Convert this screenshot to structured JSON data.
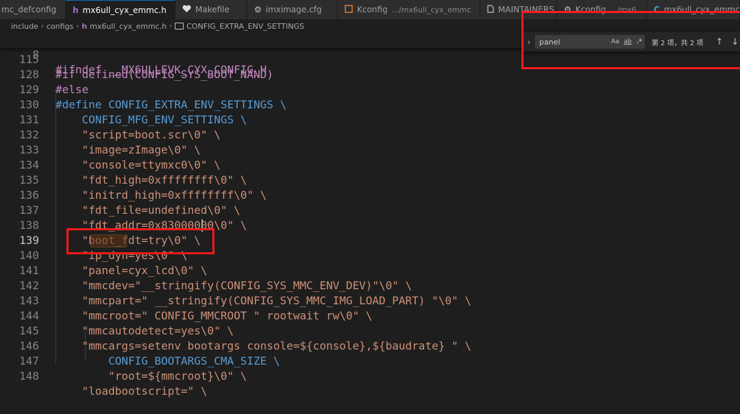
{
  "tabs": [
    {
      "label": "mc_defconfig",
      "icon": "",
      "active": false
    },
    {
      "label": "mx6ull_cyx_emmc.h",
      "icon": "h",
      "active": true
    },
    {
      "label": "Makefile",
      "icon": "makefile-icon",
      "active": false
    },
    {
      "label": "imximage.cfg",
      "icon": "gear-icon",
      "active": false
    },
    {
      "label": "Kconfig",
      "description": ".../mx6ull_cyx_emmc",
      "icon": "kconfig-icon",
      "active": false
    },
    {
      "label": "MAINTAINERS",
      "icon": "file-icon",
      "active": false
    },
    {
      "label": "Kconfig",
      "description": ".../mx6",
      "icon": "gear-icon",
      "active": false
    },
    {
      "label": "mx6ull_cyx_emmc",
      "icon": "C",
      "active": false
    }
  ],
  "breadcrumb": {
    "items": [
      "include",
      "configs",
      "mx6ull_cyx_emmc.h",
      "CONFIG_EXTRA_ENV_SETTINGS"
    ],
    "file_icon": "h"
  },
  "find": {
    "query": "panel",
    "match_case": "Aa",
    "whole_word": "ab",
    "regex": ".*",
    "count": "第 2 项，共 2 项",
    "toggle_icon": "chevron-right-icon"
  },
  "sticky": {
    "number": "8",
    "text": "#ifndef __MX6ULLEVK_CYX_CONFIG_H"
  },
  "lines": [
    {
      "n": "115",
      "t": "#if defined(CONFIG_SYS_BOOT_NAND)"
    },
    {
      "n": "128",
      "t": "#else"
    },
    {
      "n": "129",
      "t": "#define CONFIG_EXTRA_ENV_SETTINGS \\"
    },
    {
      "n": "130",
      "t": "    CONFIG_MFG_ENV_SETTINGS \\"
    },
    {
      "n": "131",
      "t": "    \"script=boot.scr\\0\" \\"
    },
    {
      "n": "132",
      "t": "    \"image=zImage\\0\" \\"
    },
    {
      "n": "133",
      "t": "    \"console=ttymxc0\\0\" \\"
    },
    {
      "n": "134",
      "t": "    \"fdt_high=0xffffffff\\0\" \\"
    },
    {
      "n": "135",
      "t": "    \"initrd_high=0xffffffff\\0\" \\"
    },
    {
      "n": "136",
      "t": "    \"fdt_file=undefined\\0\" \\"
    },
    {
      "n": "137",
      "t": "    \"fdt_addr=0x83000000\\0\" \\"
    },
    {
      "n": "138",
      "t": "    \"boot_fdt=try\\0\" \\"
    },
    {
      "n": "139",
      "t": "    \"ip_dyn=yes\\0\" \\"
    },
    {
      "n": "140",
      "t": "    \"panel=cyx_lcd\\0\" \\"
    },
    {
      "n": "141",
      "t": "    \"mmcdev=\"__stringify(CONFIG_SYS_MMC_ENV_DEV)\"\\0\" \\"
    },
    {
      "n": "142",
      "t": "    \"mmcpart=\" __stringify(CONFIG_SYS_MMC_IMG_LOAD_PART) \"\\0\" \\"
    },
    {
      "n": "143",
      "t": "    \"mmcroot=\" CONFIG_MMCROOT \" rootwait rw\\0\" \\"
    },
    {
      "n": "144",
      "t": "    \"mmcautodetect=yes\\0\" \\"
    },
    {
      "n": "145",
      "t": "    \"mmcargs=setenv bootargs console=${console},${baudrate} \" \\"
    },
    {
      "n": "146",
      "t": "        CONFIG_BOOTARGS_CMA_SIZE \\"
    },
    {
      "n": "147",
      "t": "        \"root=${mmcroot}\\0\" \\"
    },
    {
      "n": "148",
      "t": "    \"loadbootscript=\" \\"
    }
  ]
}
